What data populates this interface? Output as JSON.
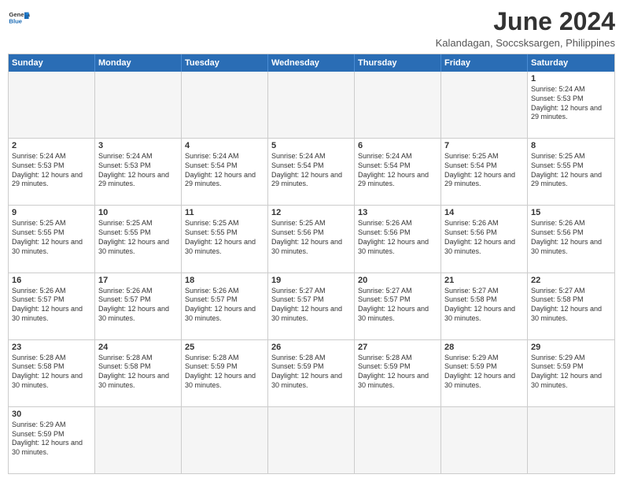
{
  "header": {
    "logo_general": "General",
    "logo_blue": "Blue",
    "main_title": "June 2024",
    "subtitle": "Kalandagan, Soccsksargen, Philippines"
  },
  "days_of_week": [
    "Sunday",
    "Monday",
    "Tuesday",
    "Wednesday",
    "Thursday",
    "Friday",
    "Saturday"
  ],
  "weeks": [
    {
      "cells": [
        {
          "day": "",
          "info": "",
          "empty": true
        },
        {
          "day": "",
          "info": "",
          "empty": true
        },
        {
          "day": "",
          "info": "",
          "empty": true
        },
        {
          "day": "",
          "info": "",
          "empty": true
        },
        {
          "day": "",
          "info": "",
          "empty": true
        },
        {
          "day": "",
          "info": "",
          "empty": true
        },
        {
          "day": "1",
          "info": "Sunrise: 5:24 AM\nSunset: 5:53 PM\nDaylight: 12 hours and 29 minutes.",
          "empty": false
        }
      ]
    },
    {
      "cells": [
        {
          "day": "2",
          "info": "Sunrise: 5:24 AM\nSunset: 5:53 PM\nDaylight: 12 hours and 29 minutes.",
          "empty": false
        },
        {
          "day": "3",
          "info": "Sunrise: 5:24 AM\nSunset: 5:53 PM\nDaylight: 12 hours and 29 minutes.",
          "empty": false
        },
        {
          "day": "4",
          "info": "Sunrise: 5:24 AM\nSunset: 5:54 PM\nDaylight: 12 hours and 29 minutes.",
          "empty": false
        },
        {
          "day": "5",
          "info": "Sunrise: 5:24 AM\nSunset: 5:54 PM\nDaylight: 12 hours and 29 minutes.",
          "empty": false
        },
        {
          "day": "6",
          "info": "Sunrise: 5:24 AM\nSunset: 5:54 PM\nDaylight: 12 hours and 29 minutes.",
          "empty": false
        },
        {
          "day": "7",
          "info": "Sunrise: 5:25 AM\nSunset: 5:54 PM\nDaylight: 12 hours and 29 minutes.",
          "empty": false
        },
        {
          "day": "8",
          "info": "Sunrise: 5:25 AM\nSunset: 5:55 PM\nDaylight: 12 hours and 29 minutes.",
          "empty": false
        }
      ]
    },
    {
      "cells": [
        {
          "day": "9",
          "info": "Sunrise: 5:25 AM\nSunset: 5:55 PM\nDaylight: 12 hours and 30 minutes.",
          "empty": false
        },
        {
          "day": "10",
          "info": "Sunrise: 5:25 AM\nSunset: 5:55 PM\nDaylight: 12 hours and 30 minutes.",
          "empty": false
        },
        {
          "day": "11",
          "info": "Sunrise: 5:25 AM\nSunset: 5:55 PM\nDaylight: 12 hours and 30 minutes.",
          "empty": false
        },
        {
          "day": "12",
          "info": "Sunrise: 5:25 AM\nSunset: 5:56 PM\nDaylight: 12 hours and 30 minutes.",
          "empty": false
        },
        {
          "day": "13",
          "info": "Sunrise: 5:26 AM\nSunset: 5:56 PM\nDaylight: 12 hours and 30 minutes.",
          "empty": false
        },
        {
          "day": "14",
          "info": "Sunrise: 5:26 AM\nSunset: 5:56 PM\nDaylight: 12 hours and 30 minutes.",
          "empty": false
        },
        {
          "day": "15",
          "info": "Sunrise: 5:26 AM\nSunset: 5:56 PM\nDaylight: 12 hours and 30 minutes.",
          "empty": false
        }
      ]
    },
    {
      "cells": [
        {
          "day": "16",
          "info": "Sunrise: 5:26 AM\nSunset: 5:57 PM\nDaylight: 12 hours and 30 minutes.",
          "empty": false
        },
        {
          "day": "17",
          "info": "Sunrise: 5:26 AM\nSunset: 5:57 PM\nDaylight: 12 hours and 30 minutes.",
          "empty": false
        },
        {
          "day": "18",
          "info": "Sunrise: 5:26 AM\nSunset: 5:57 PM\nDaylight: 12 hours and 30 minutes.",
          "empty": false
        },
        {
          "day": "19",
          "info": "Sunrise: 5:27 AM\nSunset: 5:57 PM\nDaylight: 12 hours and 30 minutes.",
          "empty": false
        },
        {
          "day": "20",
          "info": "Sunrise: 5:27 AM\nSunset: 5:57 PM\nDaylight: 12 hours and 30 minutes.",
          "empty": false
        },
        {
          "day": "21",
          "info": "Sunrise: 5:27 AM\nSunset: 5:58 PM\nDaylight: 12 hours and 30 minutes.",
          "empty": false
        },
        {
          "day": "22",
          "info": "Sunrise: 5:27 AM\nSunset: 5:58 PM\nDaylight: 12 hours and 30 minutes.",
          "empty": false
        }
      ]
    },
    {
      "cells": [
        {
          "day": "23",
          "info": "Sunrise: 5:28 AM\nSunset: 5:58 PM\nDaylight: 12 hours and 30 minutes.",
          "empty": false
        },
        {
          "day": "24",
          "info": "Sunrise: 5:28 AM\nSunset: 5:58 PM\nDaylight: 12 hours and 30 minutes.",
          "empty": false
        },
        {
          "day": "25",
          "info": "Sunrise: 5:28 AM\nSunset: 5:59 PM\nDaylight: 12 hours and 30 minutes.",
          "empty": false
        },
        {
          "day": "26",
          "info": "Sunrise: 5:28 AM\nSunset: 5:59 PM\nDaylight: 12 hours and 30 minutes.",
          "empty": false
        },
        {
          "day": "27",
          "info": "Sunrise: 5:28 AM\nSunset: 5:59 PM\nDaylight: 12 hours and 30 minutes.",
          "empty": false
        },
        {
          "day": "28",
          "info": "Sunrise: 5:29 AM\nSunset: 5:59 PM\nDaylight: 12 hours and 30 minutes.",
          "empty": false
        },
        {
          "day": "29",
          "info": "Sunrise: 5:29 AM\nSunset: 5:59 PM\nDaylight: 12 hours and 30 minutes.",
          "empty": false
        }
      ]
    },
    {
      "cells": [
        {
          "day": "30",
          "info": "Sunrise: 5:29 AM\nSunset: 5:59 PM\nDaylight: 12 hours and 30 minutes.",
          "empty": false
        },
        {
          "day": "",
          "info": "",
          "empty": true
        },
        {
          "day": "",
          "info": "",
          "empty": true
        },
        {
          "day": "",
          "info": "",
          "empty": true
        },
        {
          "day": "",
          "info": "",
          "empty": true
        },
        {
          "day": "",
          "info": "",
          "empty": true
        },
        {
          "day": "",
          "info": "",
          "empty": true
        }
      ]
    }
  ]
}
